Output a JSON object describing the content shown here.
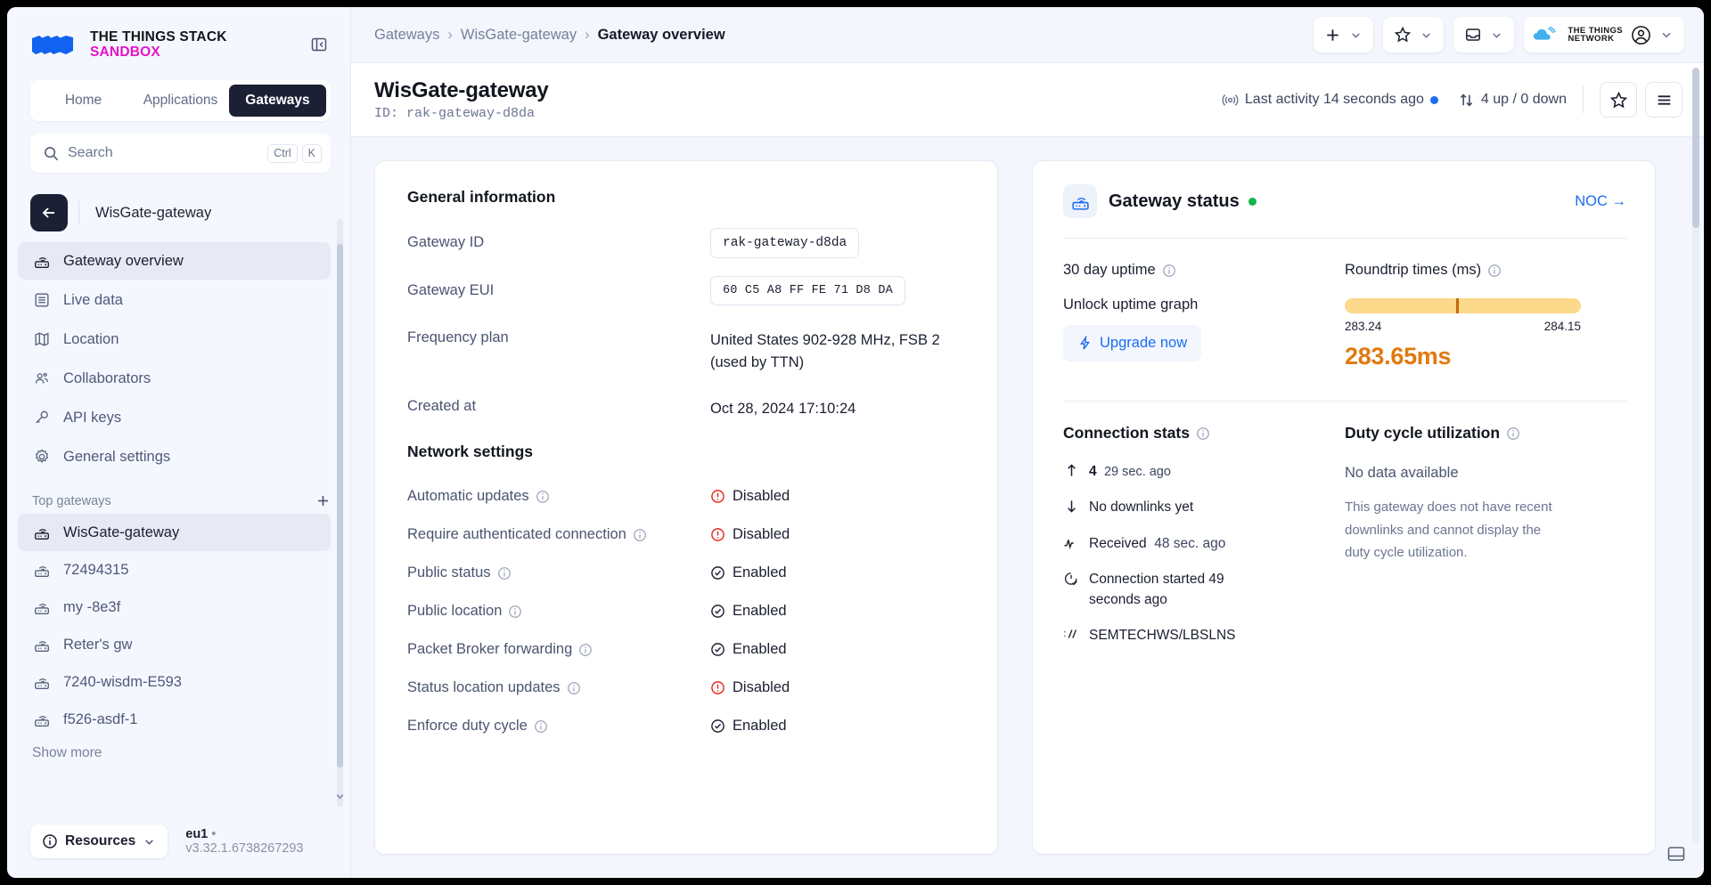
{
  "brand": {
    "line1": "THE THINGS STACK",
    "line2": "SANDBOX"
  },
  "tabs": [
    {
      "label": "Home",
      "active": false
    },
    {
      "label": "Applications",
      "active": false
    },
    {
      "label": "Gateways",
      "active": true
    }
  ],
  "search": {
    "placeholder": "Search",
    "kbd1": "Ctrl",
    "kbd2": "K"
  },
  "sidebar": {
    "back_label": "WisGate-gateway",
    "nav": [
      {
        "label": "Gateway overview",
        "icon": "gateway-icon",
        "active": true
      },
      {
        "label": "Live data",
        "icon": "list-icon",
        "active": false
      },
      {
        "label": "Location",
        "icon": "map-icon",
        "active": false
      },
      {
        "label": "Collaborators",
        "icon": "people-icon",
        "active": false
      },
      {
        "label": "API keys",
        "icon": "key-icon",
        "active": false
      },
      {
        "label": "General settings",
        "icon": "gear-icon",
        "active": false
      }
    ],
    "section_title": "Top gateways",
    "gateways": [
      {
        "label": "WisGate-gateway",
        "active": true
      },
      {
        "label": "72494315",
        "active": false
      },
      {
        "label": "my -8e3f",
        "active": false
      },
      {
        "label": "Reter's gw",
        "active": false
      },
      {
        "label": "7240-wisdm-E593",
        "active": false
      },
      {
        "label": "f526-asdf-1",
        "active": false
      }
    ],
    "show_more": "Show more",
    "resources_label": "Resources",
    "cluster": "eu1",
    "version": "v3.32.1.6738267293"
  },
  "breadcrumb": [
    {
      "label": "Gateways",
      "current": false
    },
    {
      "label": "WisGate-gateway",
      "current": false
    },
    {
      "label": "Gateway overview",
      "current": true
    }
  ],
  "page": {
    "title": "WisGate-gateway",
    "id_label": "ID: rak-gateway-d8da",
    "last_activity": "Last activity 14 seconds ago",
    "updown": "4 up / 0 down"
  },
  "general": {
    "title": "General information",
    "rows": [
      {
        "label": "Gateway ID",
        "value": "rak-gateway-d8da",
        "kind": "field"
      },
      {
        "label": "Gateway EUI",
        "value": "60 C5 A8 FF FE 71 D8 DA",
        "kind": "field-eui"
      },
      {
        "label": "Frequency plan",
        "value": "United States 902-928 MHz, FSB 2 (used by TTN)",
        "kind": "text"
      },
      {
        "label": "Created at",
        "value": "Oct 28, 2024 17:10:24",
        "kind": "text"
      }
    ]
  },
  "network": {
    "title": "Network settings",
    "rows": [
      {
        "label": "Automatic updates",
        "value": "Disabled",
        "state": "disabled"
      },
      {
        "label": "Require authenticated connection",
        "value": "Disabled",
        "state": "disabled"
      },
      {
        "label": "Public status",
        "value": "Enabled",
        "state": "enabled"
      },
      {
        "label": "Public location",
        "value": "Enabled",
        "state": "enabled"
      },
      {
        "label": "Packet Broker forwarding",
        "value": "Enabled",
        "state": "enabled"
      },
      {
        "label": "Status location updates",
        "value": "Disabled",
        "state": "disabled"
      },
      {
        "label": "Enforce duty cycle",
        "value": "Enabled",
        "state": "enabled"
      }
    ]
  },
  "status": {
    "title": "Gateway status",
    "noc_link": "NOC →",
    "uptime_label": "30 day uptime",
    "unlock_text": "Unlock uptime graph",
    "upgrade_label": "Upgrade now",
    "roundtrip_label": "Roundtrip times (ms)",
    "rt_min": "283.24",
    "rt_max": "284.15",
    "rt_current": "283.65ms",
    "connection_title": "Connection stats",
    "conn_uplink_count": "4",
    "conn_uplink_time": "29 sec. ago",
    "conn_downlink": "No downlinks yet",
    "conn_received_label": "Received",
    "conn_received_time": "48 sec. ago",
    "conn_started": "Connection started 49 seconds ago",
    "conn_protocol": "SEMTECHWS/LBSLNS",
    "duty_title": "Duty cycle utilization",
    "duty_none": "No data available",
    "duty_desc": "This gateway does not have recent downlinks and cannot display the duty cycle utilization."
  },
  "colors": {
    "accent": "#1a6cf0",
    "brand_pink": "#e612c8",
    "ok_green": "#15b54c",
    "error_red": "#e8261a",
    "amber": "#e07a10"
  }
}
